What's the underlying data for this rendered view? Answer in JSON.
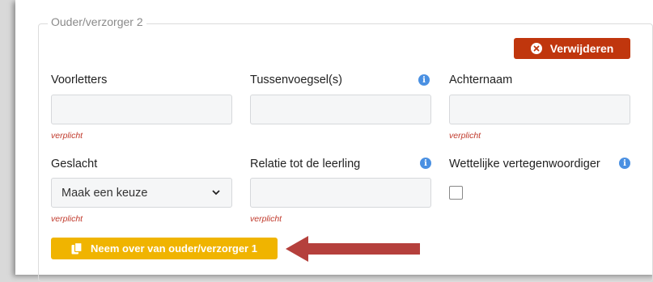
{
  "section": {
    "legend": "Ouder/verzorger 2"
  },
  "actions": {
    "delete_label": "Verwijderen",
    "copy_label": "Neem over van ouder/verzorger 1"
  },
  "fields": {
    "voorletters": {
      "label": "Voorletters",
      "value": "",
      "required": "verplicht"
    },
    "tussenvoegsel": {
      "label": "Tussenvoegsel(s)",
      "value": ""
    },
    "achternaam": {
      "label": "Achternaam",
      "value": "",
      "required": "verplicht"
    },
    "geslacht": {
      "label": "Geslacht",
      "selected": "Maak een keuze",
      "required": "verplicht"
    },
    "relatie": {
      "label": "Relatie tot de leerling",
      "value": "",
      "required": "verplicht"
    },
    "wettelijk": {
      "label": "Wettelijke vertegenwoordiger",
      "checked": false
    }
  },
  "icons": {
    "delete": "x-circle-icon",
    "info": "info-icon",
    "copy": "copy-icon",
    "chevron": "chevron-down-icon",
    "arrow": "arrow-left-icon"
  },
  "colors": {
    "delete": "#c0360d",
    "copy": "#f0b400",
    "info": "#4a90e2",
    "required": "#c0392b",
    "arrow": "#b5403c"
  }
}
